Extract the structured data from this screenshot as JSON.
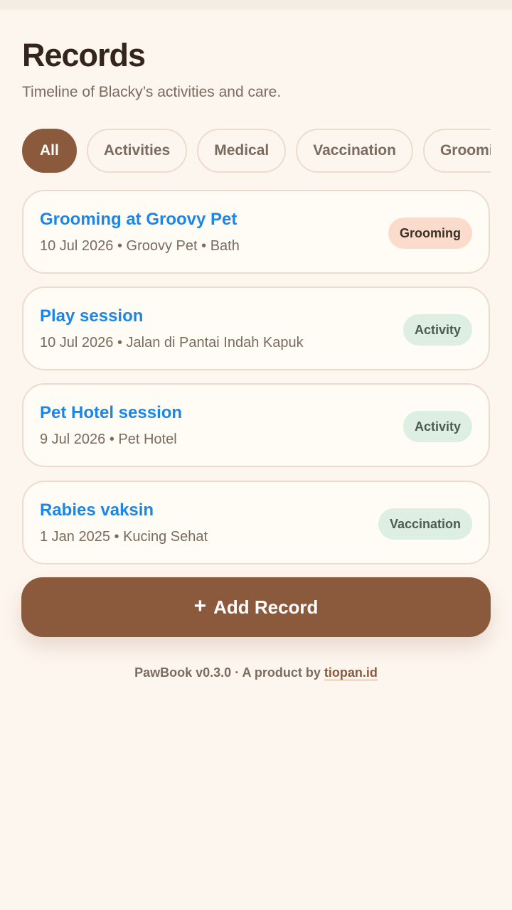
{
  "header": {
    "title": "Records",
    "subtitle": "Timeline of Blacky’s activities and care."
  },
  "filters": [
    {
      "label": "All",
      "active": true
    },
    {
      "label": "Activities",
      "active": false
    },
    {
      "label": "Medical",
      "active": false
    },
    {
      "label": "Vaccination",
      "active": false
    },
    {
      "label": "Grooming",
      "active": false
    }
  ],
  "records": [
    {
      "title": "Grooming at Groovy Pet",
      "meta": "10 Jul 2026 • Groovy Pet • Bath",
      "tag": "Grooming",
      "tag_type": "grooming"
    },
    {
      "title": "Play session",
      "meta": "10 Jul 2026 • Jalan di Pantai Indah Kapuk",
      "tag": "Activity",
      "tag_type": "activity"
    },
    {
      "title": "Pet Hotel session",
      "meta": "9 Jul 2026 • Pet Hotel",
      "tag": "Activity",
      "tag_type": "activity"
    },
    {
      "title": "Rabies vaksin",
      "meta": "1 Jan 2025 • Kucing Sehat",
      "tag": "Vaccination",
      "tag_type": "vaccination"
    }
  ],
  "add_button": {
    "icon": "plus-icon",
    "label": "Add Record"
  },
  "footer": {
    "text": "PawBook v0.3.0 · A product by ",
    "link": "tiopan.id"
  },
  "colors": {
    "background": "#fdf6ef",
    "accent": "#8b5a3c",
    "title_link": "#1a87e8",
    "grooming_tag": "#fbdccc",
    "activity_tag": "#dcefe2"
  }
}
